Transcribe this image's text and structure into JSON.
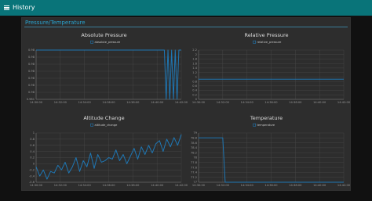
{
  "app": {
    "title": "History"
  },
  "group": {
    "title": "Pressure/Temperature"
  },
  "colors": {
    "topbar": "#097479",
    "series": "#1f77b4",
    "group_title": "#2aa3cf"
  },
  "chart_data": [
    {
      "type": "line",
      "title": "Absolute Pressure",
      "legend": "absolute_pressure",
      "x_ticks": [
        "14:30:00",
        "14:32:00",
        "14:34:00",
        "14:36:00",
        "14:38:00",
        "14:40:00",
        "14:42:00"
      ],
      "y_ticks": [
        "0.981",
        "0.98",
        "0.98",
        "0.98",
        "0.98",
        "0.98",
        "0.98",
        "0.98"
      ],
      "ylim": [
        0,
        7
      ],
      "xlim": [
        0,
        12
      ],
      "x": [
        0,
        10.6,
        10.75,
        10.9,
        11.05,
        11.2,
        11.35,
        11.5,
        11.65,
        11.8,
        12
      ],
      "y": [
        7,
        7,
        0,
        7,
        0,
        7,
        0,
        7,
        0,
        7,
        7
      ]
    },
    {
      "type": "line",
      "title": "Relative Pressure",
      "legend": "relative_pressure",
      "x_ticks": [
        "14:30:00",
        "14:32:00",
        "14:34:00",
        "14:36:00",
        "14:38:00",
        "14:40:00",
        "14:42:00"
      ],
      "y_ticks": [
        "0",
        "0.2",
        "0.4",
        "0.6",
        "0.8",
        "1",
        "1.2",
        "1.4",
        "1.6",
        "1.8",
        "2",
        "2.2"
      ],
      "ylim": [
        0,
        2.2
      ],
      "xlim": [
        0,
        12
      ],
      "x": [
        0,
        12
      ],
      "y": [
        0.9,
        0.9
      ]
    },
    {
      "type": "line",
      "title": "Altitude Change",
      "legend": "altitude_change",
      "x_ticks": [
        "14:30:00",
        "14:32:00",
        "14:34:00",
        "14:36:00",
        "14:38:00",
        "14:40:00",
        "14:42:00"
      ],
      "y_ticks": [
        "-0.6",
        "-0.4",
        "-0.2",
        "0",
        "0.2",
        "0.4",
        "0.6",
        "0.8",
        "1"
      ],
      "ylim": [
        -0.6,
        1
      ],
      "xlim": [
        0,
        12
      ],
      "x": [
        0,
        0.3,
        0.6,
        0.9,
        1.2,
        1.5,
        1.8,
        2.1,
        2.4,
        2.7,
        3.0,
        3.3,
        3.6,
        3.9,
        4.2,
        4.5,
        4.8,
        5.1,
        5.4,
        5.7,
        6.0,
        6.3,
        6.6,
        6.9,
        7.2,
        7.5,
        7.8,
        8.1,
        8.4,
        8.7,
        9.0,
        9.3,
        9.6,
        9.9,
        10.2,
        10.5,
        10.8,
        11.1,
        11.4,
        11.7,
        12.0
      ],
      "y": [
        -0.1,
        -0.4,
        -0.2,
        -0.5,
        -0.25,
        -0.3,
        -0.05,
        -0.2,
        0.05,
        -0.3,
        -0.1,
        0.2,
        -0.25,
        0.1,
        -0.1,
        0.35,
        -0.15,
        0.3,
        0.05,
        0.1,
        0.2,
        0.15,
        0.45,
        0.1,
        0.3,
        0.0,
        0.25,
        0.5,
        0.15,
        0.55,
        0.3,
        0.6,
        0.35,
        0.65,
        0.75,
        0.4,
        0.8,
        0.55,
        0.85,
        0.6,
        0.95
      ]
    },
    {
      "type": "line",
      "title": "Temperature",
      "legend": "temperature",
      "x_ticks": [
        "14:30:00",
        "14:32:00",
        "14:34:00",
        "14:36:00",
        "14:38:00",
        "14:40:00",
        "14:42:00"
      ],
      "y_ticks": [
        "77",
        "77.2",
        "77.4",
        "77.6",
        "77.8",
        "78",
        "78.2",
        "78.4",
        "78.6",
        "78.8",
        "79"
      ],
      "ylim": [
        77,
        79
      ],
      "xlim": [
        0,
        12
      ],
      "x": [
        0,
        2.0,
        2.2,
        12
      ],
      "y": [
        78.8,
        78.8,
        77.0,
        77.0
      ]
    }
  ]
}
